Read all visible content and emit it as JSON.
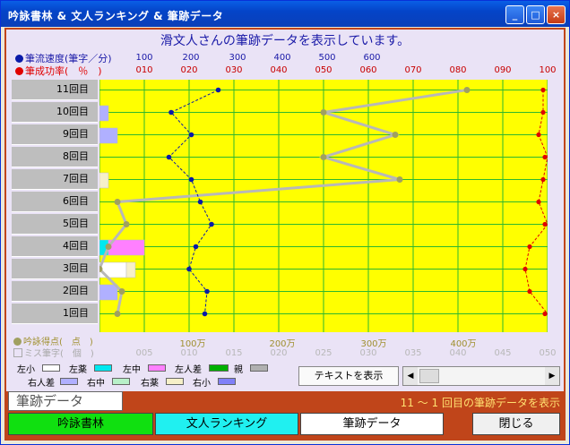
{
  "window": {
    "title": "吟詠書林 & 文人ランキング & 筆跡データ",
    "controls": [
      "_",
      "□",
      "×"
    ]
  },
  "header": {
    "text": "滑文人さんの筆跡データを表示しています。"
  },
  "legend": {
    "speed": "筆流速度(筆字／分)",
    "success": "筆成功率(　％　)",
    "score": "吟詠得点(　点　)",
    "miss": "ミス筆字(　個　)"
  },
  "axes": {
    "speed_ticks": [
      "100",
      "200",
      "300",
      "400",
      "500",
      "600"
    ],
    "success_ticks": [
      "010",
      "020",
      "030",
      "040",
      "050",
      "060",
      "070",
      "080",
      "090",
      "100"
    ],
    "score_ticks": [
      "100万",
      "200万",
      "300万",
      "400万"
    ],
    "miss_ticks": [
      "005",
      "010",
      "015",
      "020",
      "025",
      "030",
      "035",
      "040",
      "045",
      "050"
    ]
  },
  "colors": {
    "plot": "#ffff00",
    "grid": "#2eb82e",
    "speed_dot": "#0a1aa8",
    "success_dot": "#e00000",
    "score_line": "#b8b8b8",
    "score_dot": "#a0a060"
  },
  "chart_data": {
    "type": "line",
    "categories": [
      "11回目",
      "10回目",
      "9回目",
      "8回目",
      "7回目",
      "6回目",
      "5回目",
      "4回目",
      "3回目",
      "2回目",
      "1回目"
    ],
    "speed_xlim": [
      0,
      700
    ],
    "success_xlim": [
      0,
      100
    ],
    "score_xlim": [
      0,
      4500000
    ],
    "series": [
      {
        "name": "筆流速度(筆字／分)",
        "values": [
          265,
          160,
          205,
          155,
          205,
          225,
          250,
          215,
          200,
          240,
          235
        ]
      },
      {
        "name": "筆成功率(　％　)",
        "values": [
          99,
          99,
          98,
          100,
          99,
          98,
          100,
          96,
          95,
          96,
          100
        ]
      },
      {
        "name": "吟詠得点(　点　)",
        "values": [
          4100000,
          2500000,
          3300000,
          2500000,
          3350000,
          200000,
          300000,
          100000,
          0,
          250000,
          200000
        ]
      }
    ],
    "miss_bars": [
      {
        "row": "10回目",
        "segments": [
          {
            "kind": "右人差",
            "value": 1
          }
        ]
      },
      {
        "row": "9回目",
        "segments": [
          {
            "kind": "右人差",
            "value": 2
          }
        ]
      },
      {
        "row": "7回目",
        "segments": [
          {
            "kind": "右薬",
            "value": 1
          }
        ]
      },
      {
        "row": "4回目",
        "segments": [
          {
            "kind": "左薬",
            "value": 1
          },
          {
            "kind": "左中",
            "value": 4
          }
        ]
      },
      {
        "row": "3回目",
        "segments": [
          {
            "kind": "左小",
            "value": 3
          },
          {
            "kind": "右薬",
            "value": 1
          }
        ]
      },
      {
        "row": "2回目",
        "segments": [
          {
            "kind": "右人差",
            "value": 2
          }
        ]
      }
    ]
  },
  "finger_legend": [
    {
      "label": "左小",
      "color": "#ffffff"
    },
    {
      "label": "左薬",
      "color": "#00e8f0"
    },
    {
      "label": "左中",
      "color": "#ff80ff"
    },
    {
      "label": "左人差",
      "color": "#00b000"
    },
    {
      "label": "親",
      "color": "#b0b0b0"
    },
    {
      "label": "右人差",
      "color": "#b0b0ff"
    },
    {
      "label": "右中",
      "color": "#b8f0c8"
    },
    {
      "label": "右薬",
      "color": "#f6f0c8"
    },
    {
      "label": "右小",
      "color": "#8080f8"
    }
  ],
  "buttons": {
    "text": "テキストを表示",
    "close": "閉じる",
    "nav": [
      "吟詠書林",
      "文人ランキング",
      "筆跡データ"
    ]
  },
  "status": {
    "section": "筆跡データ",
    "range": "11 ～ 1 回目の筆跡データを表示"
  }
}
